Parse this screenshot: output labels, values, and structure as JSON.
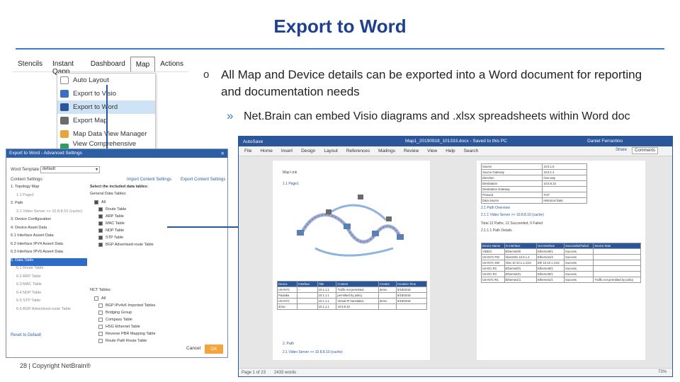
{
  "slide": {
    "title": "Export to Word",
    "bullet1": "All Map and Device details can be exported into a Word document for reporting and documentation needs",
    "bullet1_mark": "o",
    "bullet2": "Net.Brain can embed Visio diagrams and .xlsx spreadsheets within Word doc",
    "bullet2_mark": "»",
    "footer": "28 | Copyright NetBrain®"
  },
  "menu": {
    "tabs": [
      "Stencils",
      "Instant Qapp",
      "Dashboard",
      "Map",
      "Actions"
    ],
    "active_tab": "Map",
    "items": [
      {
        "label": "Auto Layout",
        "icon_color": "#ffffff"
      },
      {
        "label": "Export to Visio",
        "icon_color": "#3a6fc4"
      },
      {
        "label": "Export to Word",
        "icon_color": "#2b579a"
      },
      {
        "label": "Export Map",
        "icon_color": "#6b6b6b"
      },
      {
        "label": "Map Data View Manager",
        "icon_color": "#e8a33a"
      },
      {
        "label": "View Comprehensive Report",
        "icon_color": "#2b9c62"
      }
    ],
    "selected_item": "Export to Word"
  },
  "dialog": {
    "title": "Export to Word - Advanced Settings",
    "template_label": "Word Template:",
    "template_value": "default",
    "content_label": "Content Settings:",
    "import_link": "Import Content Settings",
    "export_link": "Export Content Settings",
    "tree": [
      "1. Topology Map",
      "1.1 Page1",
      "2. Path",
      "2.1 Video Server >> 10.8.8.10 (cache)",
      "3. Device Configuration",
      "4. Device Asset Data",
      "6.1 Interface Assert Data",
      "6.2 Interface IPV4 Assert Data",
      "6.3 Interface IPV6 Assert Data",
      "6. Data Table",
      "6.1 Route Table",
      "6.2 ARP Table",
      "6.3 MAC Table",
      "6.4 NDP Table",
      "6.5 STP Table",
      "6.6 BGP Advertised-route Table"
    ],
    "tree_selected": "6. Data Table",
    "select_tables_title": "Select the included data tables:",
    "general_tables_label": "General Data Tables:",
    "general_tables": [
      "All",
      "Route Table",
      "ARP Table",
      "MAC Table",
      "NDP Table",
      "STP Table",
      "BGP Advertised-route Table"
    ],
    "nct_tables_label": "NCT Tables:",
    "nct_tables": [
      "All",
      "BGP IPv4v6 Imported Tables",
      "Bridging Group",
      "Compass Table",
      "HSG Ethernet Table",
      "Reverse PBR Mapping Table",
      "Route Path Route Table"
    ],
    "reset_label": "Reset to Default",
    "cancel_label": "Cancel",
    "ok_label": "OK",
    "accent_color": "#f4a43a"
  },
  "word": {
    "title_left": "AutoSave",
    "title_center": "Map1_20190918_101333.docx - Saved to this PC",
    "title_user": "Daniel Ferrantino",
    "ribbon": [
      "File",
      "Home",
      "Insert",
      "Design",
      "Layout",
      "References",
      "Mailings",
      "Review",
      "View",
      "Help",
      "Search"
    ],
    "share": "Share",
    "comments": "Comments",
    "page1": {
      "heading": "Map Link",
      "section": "1.1 Page1",
      "path_heading": "2. Path",
      "path_item": "2.1 Video Server >> 10.8.8.10 (cache)"
    },
    "page2": {
      "section_path": "2.1 Path Overview",
      "section_video": "2.1.1 Video Server >> 10.8.8.10 (cache)",
      "total": "Total 12 Paths, 12 Succeeded, 0 Failed",
      "path_detail": "2.1.1.1 Path Details",
      "table_headers": [
        "Device Name",
        "In Interface",
        "Out Interface",
        "Successful/Failed",
        "Device Note"
      ],
      "table_rows": [
        [
          "VIDEO",
          "Ethernet0/0",
          "Ethernet0/1",
          "Success",
          ""
        ],
        [
          "US-NYC-FW",
          "Vlan1001 10.8.1.4",
          "Ethernet1/3",
          "Success",
          ""
        ],
        [
          "US-NYC-SW",
          "Vlan 10 10.1.1.1/24",
          "Eth 10.10.1.1/24",
          "Success",
          ""
        ],
        [
          "US-DC-R2",
          "Ethernet0/1",
          "Ethernet0/2",
          "Success",
          ""
        ],
        [
          "US-DC-R3",
          "Ethernet0/1",
          "Ethernet0/1",
          "Success",
          ""
        ],
        [
          "US-NYC-R1",
          "Ethernet1/1",
          "Ethernet1/1",
          "Success",
          "Traffic not permitted by policy"
        ]
      ]
    },
    "status_left": "Page 1 of 23",
    "status_words": "2433 words",
    "zoom": "73%"
  }
}
